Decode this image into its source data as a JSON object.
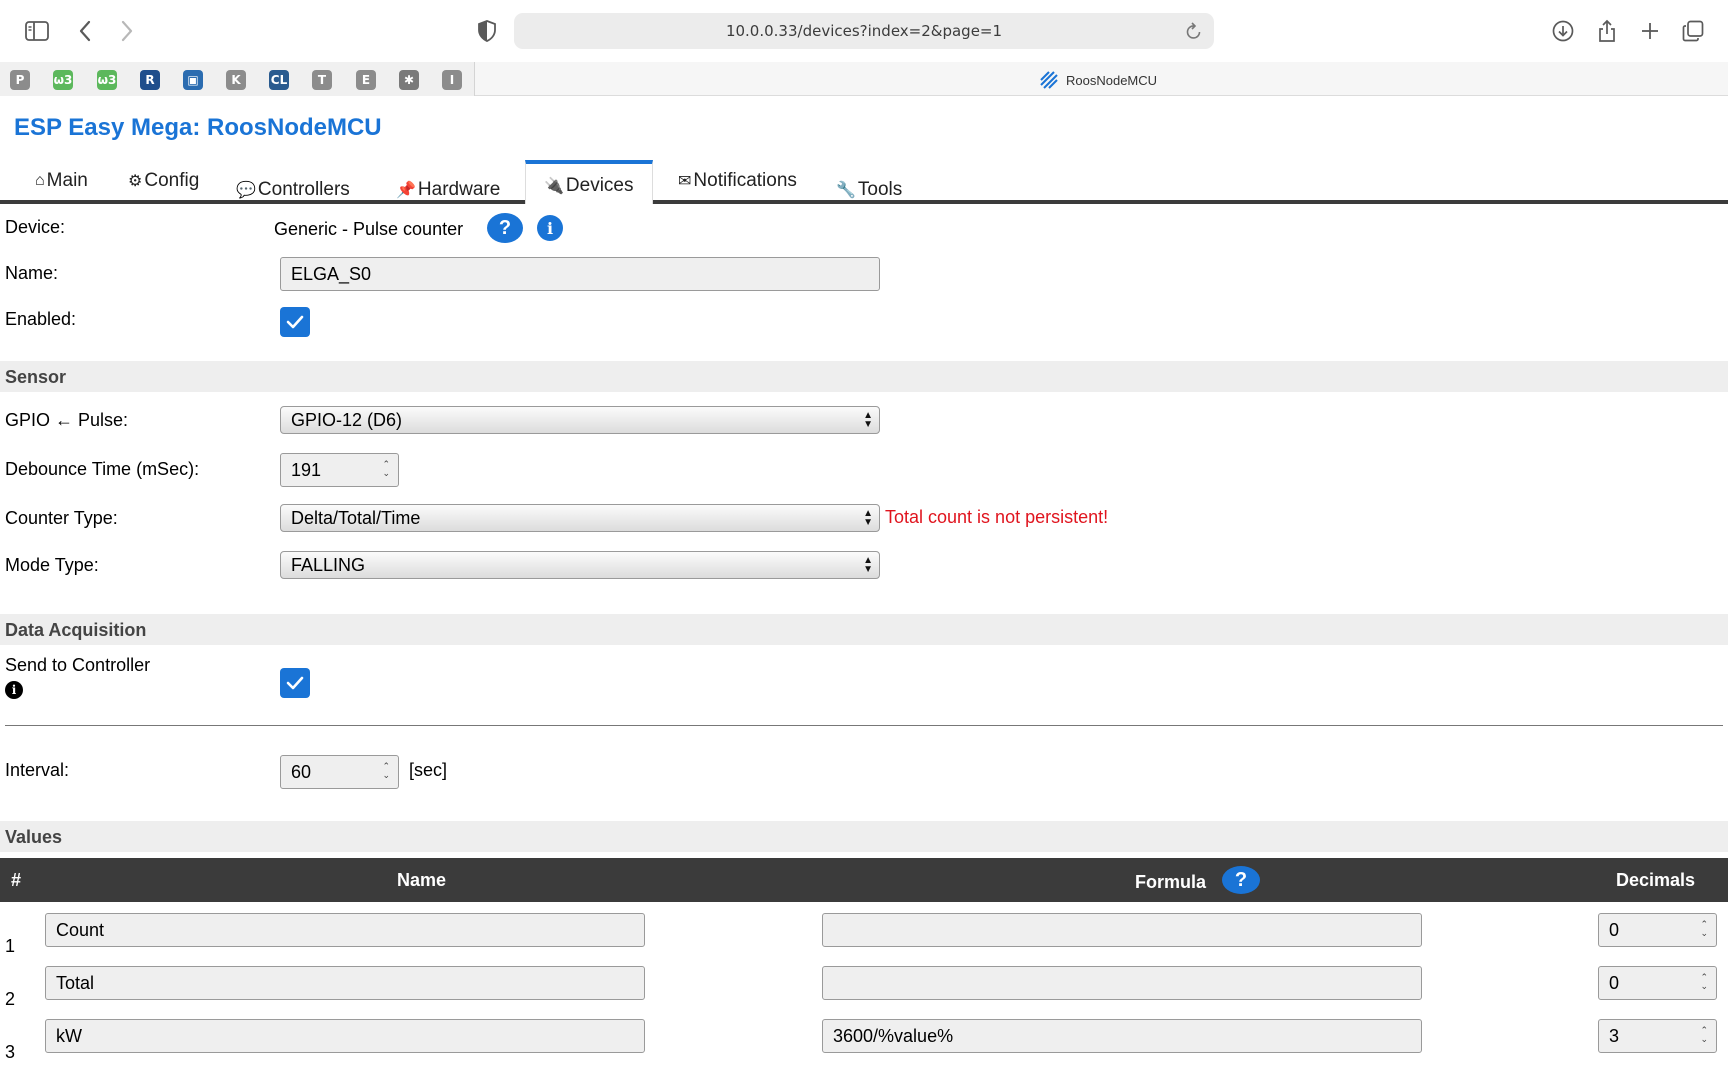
{
  "browser": {
    "url": "10.0.0.33/devices?index=2&page=1",
    "tab_title": "RoosNodeMCU",
    "favorites": [
      {
        "letter": "P",
        "color": "#8c8c8c"
      },
      {
        "letter": "ω3",
        "color": "#5cb85c"
      },
      {
        "letter": "ω3",
        "color": "#5cb85c"
      },
      {
        "letter": "R",
        "color": "#1f4e8c"
      },
      {
        "letter": "▣",
        "color": "#2b6cb0"
      },
      {
        "letter": "K",
        "color": "#8c8c8c"
      },
      {
        "letter": "CL",
        "color": "#2a5b8f"
      },
      {
        "letter": "T",
        "color": "#8c8c8c"
      },
      {
        "letter": "E",
        "color": "#8c8c8c"
      },
      {
        "letter": "✱",
        "color": "#7a7a7a"
      },
      {
        "letter": "I",
        "color": "#8c8c8c"
      }
    ]
  },
  "app": {
    "title": "ESP Easy Mega: RoosNodeMCU",
    "accent_color": "#1a74d6"
  },
  "menu": [
    {
      "icon": "⌂",
      "label": "Main"
    },
    {
      "icon": "⚙",
      "label": "Config"
    },
    {
      "icon": "💬",
      "label": "Controllers"
    },
    {
      "icon": "📌",
      "label": "Hardware"
    },
    {
      "icon": "🔌",
      "label": "Devices"
    },
    {
      "icon": "✉",
      "label": "Notifications"
    },
    {
      "icon": "🔧",
      "label": "Tools"
    }
  ],
  "form": {
    "device_label": "Device:",
    "device_value": "Generic - Pulse counter",
    "name_label": "Name:",
    "name_value": "ELGA_S0",
    "enabled_label": "Enabled:",
    "enabled": true,
    "sensor_section": "Sensor",
    "gpio_label": "GPIO ← Pulse:",
    "gpio_value": "GPIO-12 (D6)",
    "debounce_label": "Debounce Time (mSec):",
    "debounce_value": "191",
    "counter_type_label": "Counter Type:",
    "counter_type_value": "Delta/Total/Time",
    "counter_warning": "Total count is not persistent!",
    "mode_type_label": "Mode Type:",
    "mode_type_value": "FALLING",
    "data_section": "Data Acquisition",
    "send_label": "Send to Controller",
    "send_enabled": true,
    "interval_label": "Interval:",
    "interval_value": "60",
    "interval_unit": "[sec]",
    "values_section": "Values"
  },
  "values_table": {
    "headers": {
      "num": "#",
      "name": "Name",
      "formula": "Formula",
      "decimals": "Decimals"
    },
    "rows": [
      {
        "num": "1",
        "name": "Count",
        "formula": "",
        "decimals": "0"
      },
      {
        "num": "2",
        "name": "Total",
        "formula": "",
        "decimals": "0"
      },
      {
        "num": "3",
        "name": "kW",
        "formula": "3600/%value%",
        "decimals": "3"
      }
    ]
  }
}
